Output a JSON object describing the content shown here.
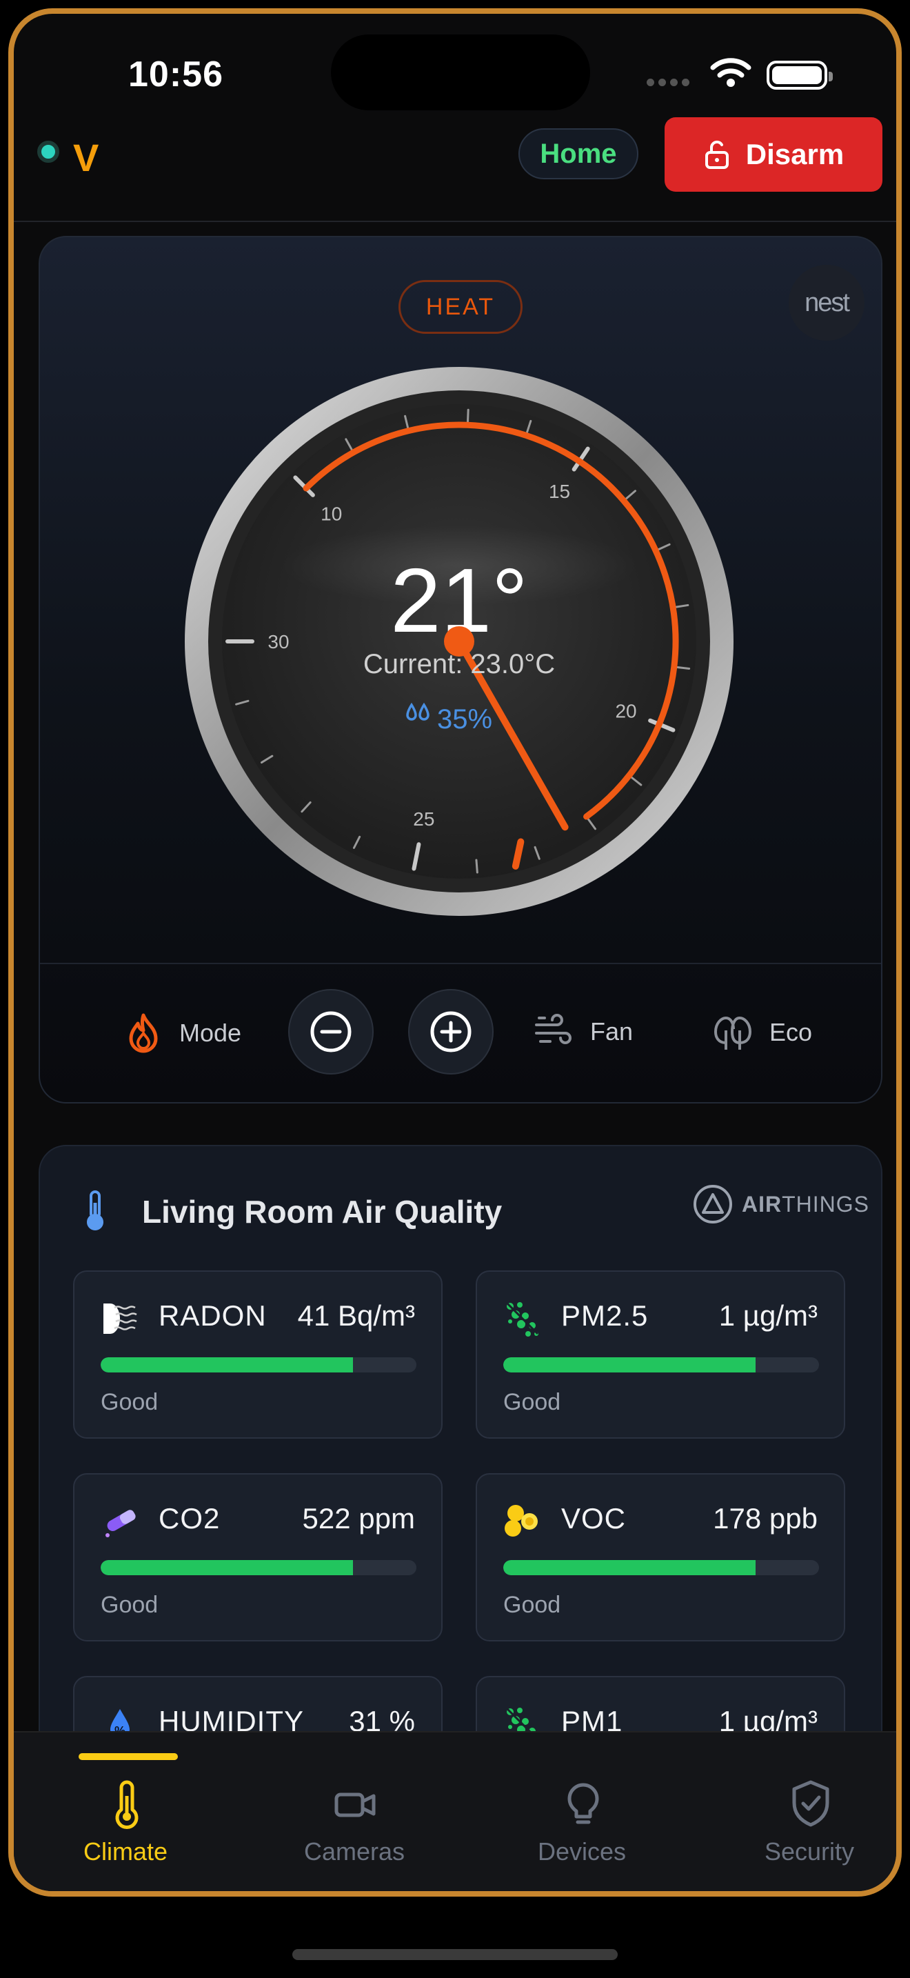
{
  "status_bar": {
    "time": "10:56"
  },
  "header": {
    "logo": "V",
    "home_label": "Home",
    "disarm_label": "Disarm"
  },
  "thermostat": {
    "mode_badge": "HEAT",
    "brand": "nest",
    "target_temp": "21°",
    "current": "Current: 23.0°C",
    "humidity": "35%",
    "scale_labels": [
      "10",
      "15",
      "20",
      "25",
      "30"
    ],
    "controls": {
      "mode": "Mode",
      "fan": "Fan",
      "eco": "Eco"
    },
    "accent_color": "#f05a14"
  },
  "air_quality": {
    "title": "Living Room Air Quality",
    "brand_bold": "AIR",
    "brand_light": "THINGS",
    "metrics": [
      {
        "name": "RADON",
        "value": "41 Bq/m³",
        "status": "Good",
        "level": 0.8,
        "icon": "radon-icon"
      },
      {
        "name": "PM2.5",
        "value": "1 µg/m³",
        "status": "Good",
        "level": 0.8,
        "icon": "particles-icon"
      },
      {
        "name": "CO2",
        "value": "522 ppm",
        "status": "Good",
        "level": 0.8,
        "icon": "test-tube-icon"
      },
      {
        "name": "VOC",
        "value": "178 ppb",
        "status": "Good",
        "level": 0.8,
        "icon": "molecule-icon"
      },
      {
        "name": "HUMIDITY",
        "value": "31 %",
        "status": "",
        "level": 0,
        "icon": "humidity-drop-icon"
      },
      {
        "name": "PM1",
        "value": "1 µg/m³",
        "status": "",
        "level": 0,
        "icon": "particles-icon"
      }
    ]
  },
  "tabs": [
    {
      "label": "Climate",
      "active": true,
      "icon": "thermometer-icon"
    },
    {
      "label": "Cameras",
      "active": false,
      "icon": "camera-icon"
    },
    {
      "label": "Devices",
      "active": false,
      "icon": "lightbulb-icon"
    },
    {
      "label": "Security",
      "active": false,
      "icon": "shield-check-icon"
    }
  ]
}
